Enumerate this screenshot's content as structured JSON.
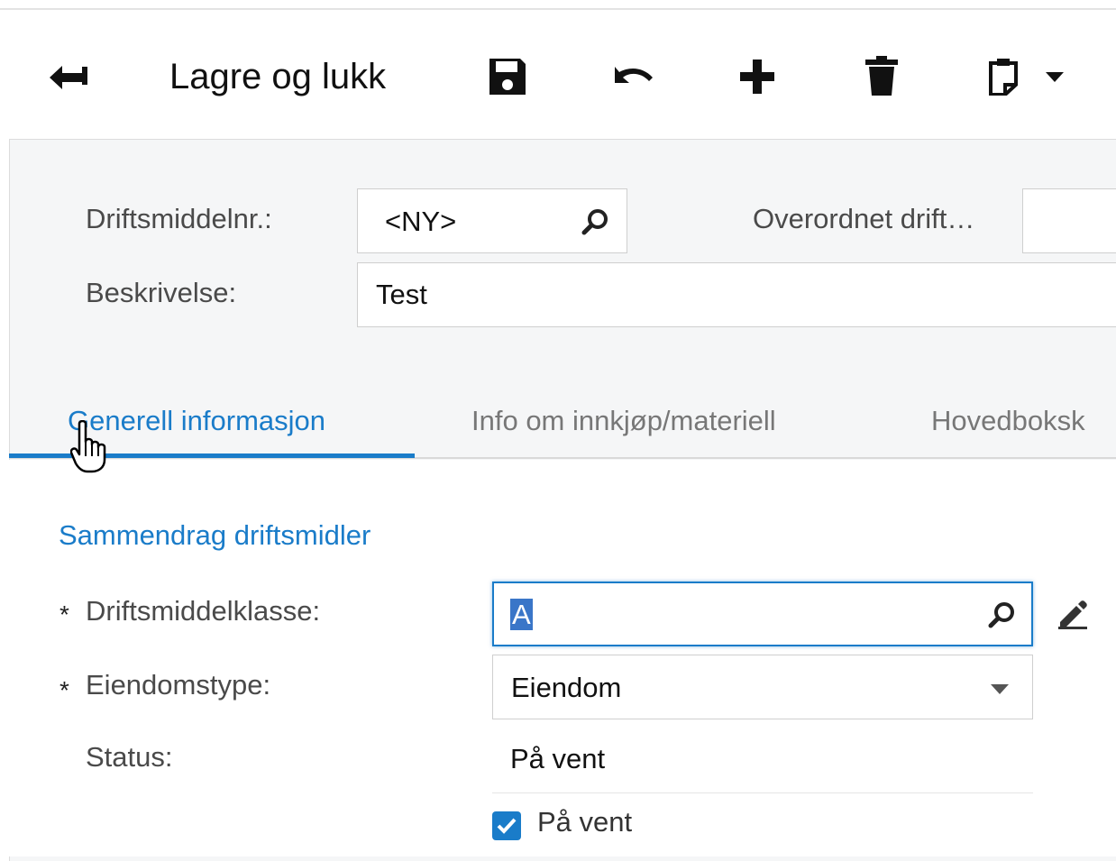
{
  "toolbar": {
    "back_icon": "arrow-back-icon",
    "save_close_label": "Lagre og lukk",
    "save_icon": "floppy-disk-icon",
    "undo_icon": "undo-icon",
    "add_icon": "plus-icon",
    "delete_icon": "trash-icon",
    "copy_paste_icon": "clipboard-icon",
    "dropdown_icon": "caret-down-icon"
  },
  "header": {
    "asset_no_label": "Driftsmiddelnr.:",
    "asset_no_value": "<NY>",
    "parent_asset_label": "Overordnet drift…",
    "parent_asset_value": "",
    "description_label": "Beskrivelse:",
    "description_value": "Test"
  },
  "tabs": [
    {
      "label": "Generell informasjon",
      "active": true
    },
    {
      "label": "Info om innkjøp/materiell",
      "active": false
    },
    {
      "label": "Hovedboksk",
      "active": false
    }
  ],
  "section": {
    "title": "Sammendrag driftsmidler",
    "asset_class_label": "Driftsmiddelklasse:",
    "asset_class_value": "A",
    "property_type_label": "Eiendomstype:",
    "property_type_value": "Eiendom",
    "status_label": "Status:",
    "status_value": "På vent",
    "hold_checkbox_label": "På vent",
    "hold_checked": true,
    "required_marker": "*"
  },
  "colors": {
    "accent": "#1a7cc9",
    "panel_bg": "#f5f6f7"
  }
}
